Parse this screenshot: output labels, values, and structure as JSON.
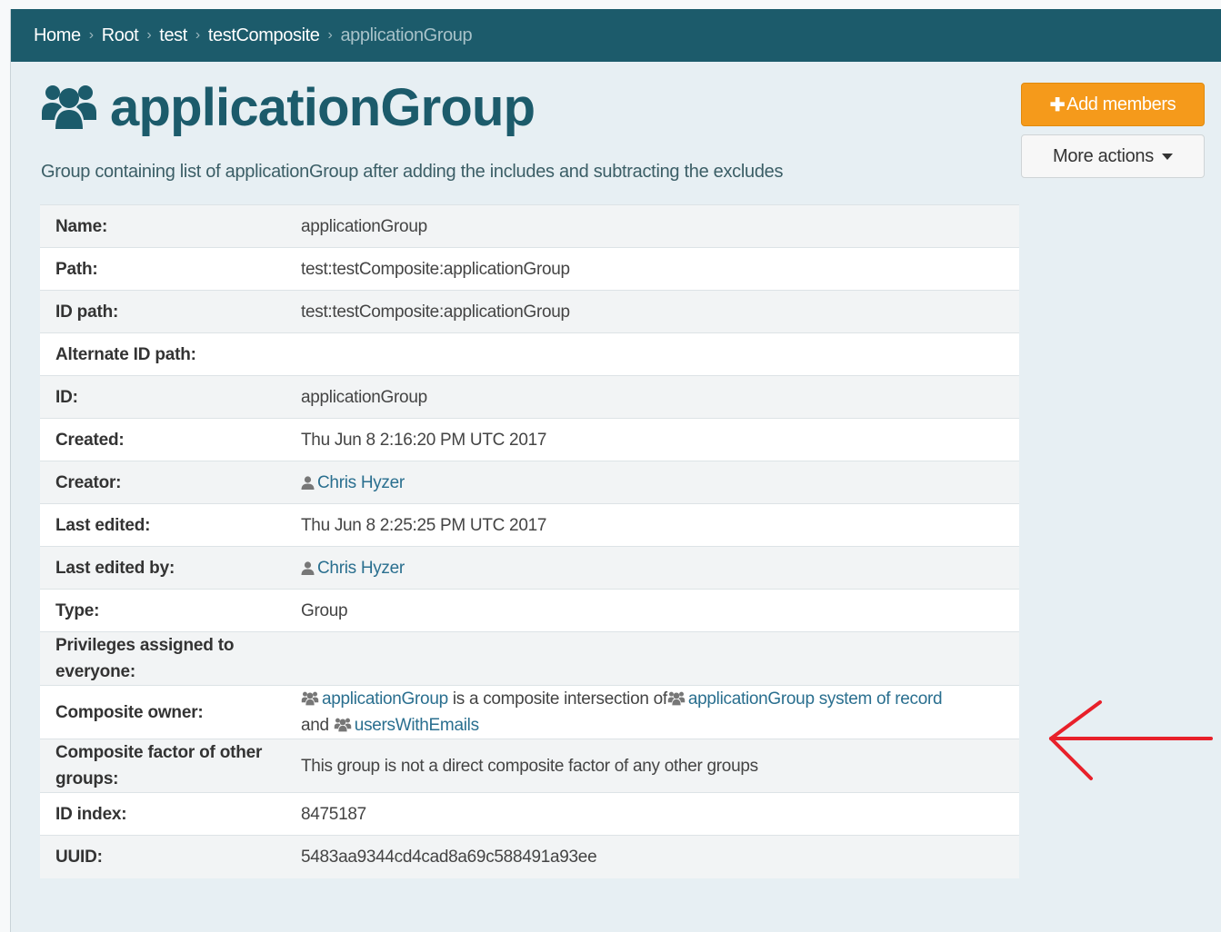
{
  "breadcrumb": {
    "items": [
      "Home",
      "Root",
      "test",
      "testComposite"
    ],
    "current": "applicationGroup",
    "separator": "›"
  },
  "page": {
    "title": "applicationGroup",
    "description": "Group containing list of applicationGroup after adding the includes and subtracting the excludes"
  },
  "actions": {
    "add_members": "Add members",
    "more_actions": "More actions"
  },
  "properties": {
    "name": {
      "label": "Name:",
      "value": "applicationGroup"
    },
    "path": {
      "label": "Path:",
      "value": "test:testComposite:applicationGroup"
    },
    "id_path": {
      "label": "ID path:",
      "value": "test:testComposite:applicationGroup"
    },
    "alt_id_path": {
      "label": "Alternate ID path:",
      "value": ""
    },
    "id": {
      "label": "ID:",
      "value": "applicationGroup"
    },
    "created": {
      "label": "Created:",
      "value": "Thu Jun 8 2:16:20 PM UTC 2017"
    },
    "creator": {
      "label": "Creator:",
      "value": "Chris Hyzer"
    },
    "last_edited": {
      "label": "Last edited:",
      "value": "Thu Jun 8 2:25:25 PM UTC 2017"
    },
    "last_edited_by": {
      "label": "Last edited by:",
      "value": "Chris Hyzer"
    },
    "type": {
      "label": "Type:",
      "value": "Group"
    },
    "privileges": {
      "label": "Privileges assigned to everyone:",
      "value": ""
    },
    "composite_owner": {
      "label": "Composite owner:",
      "group": "applicationGroup",
      "text1": "is a composite intersection of",
      "left_factor": "applicationGroup system of record",
      "text2": "and",
      "right_factor": "usersWithEmails"
    },
    "composite_factor": {
      "label": "Composite factor of other groups:",
      "value": "This group is not a direct composite factor of any other groups"
    },
    "id_index": {
      "label": "ID index:",
      "value": "8475187"
    },
    "uuid": {
      "label": "UUID:",
      "value": "5483aa9344cd4cad8a69c588491a93ee"
    }
  },
  "colors": {
    "brand": "#1c5b6b",
    "accent": "#f59a1b",
    "link": "#2a6f8f",
    "annotation_arrow": "#e8202a"
  },
  "icons": {
    "group": "group-icon",
    "user": "user-icon",
    "plus": "plus-icon",
    "caret": "caret-down-icon"
  }
}
